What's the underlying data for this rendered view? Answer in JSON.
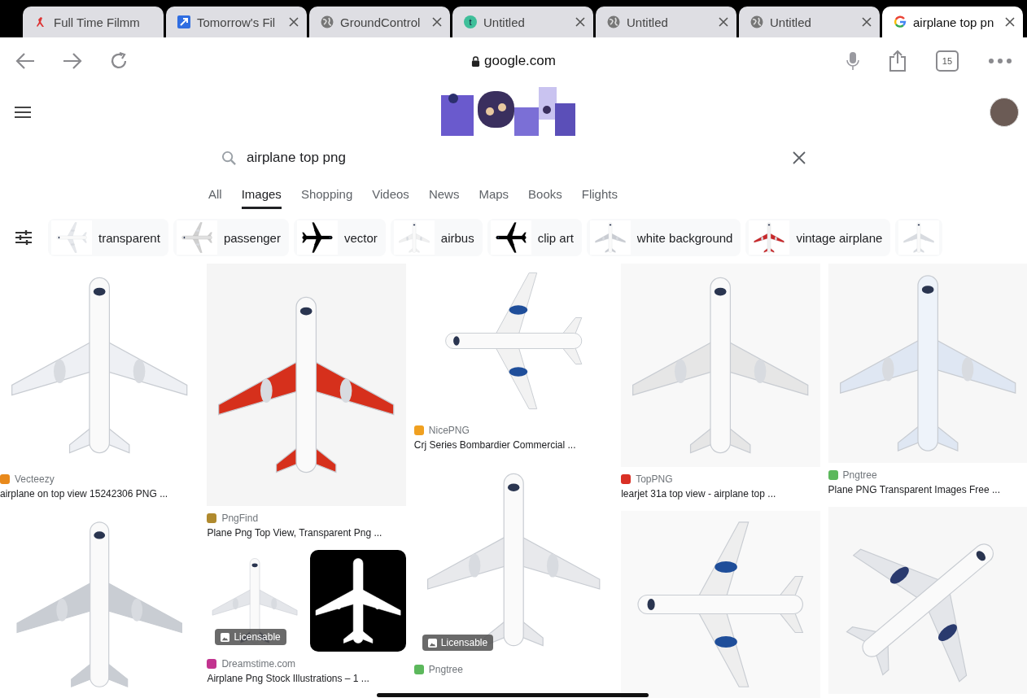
{
  "browser": {
    "tabs": [
      {
        "title": "Full Time Filmm",
        "kind": "figure",
        "closable": false,
        "selected": false
      },
      {
        "title": "Tomorrow's Fil",
        "kind": "square",
        "closable": true,
        "selected": false
      },
      {
        "title": "GroundControl",
        "kind": "globe",
        "closable": true,
        "selected": false
      },
      {
        "title": "Untitled",
        "kind": "letter",
        "favicon_text": "t",
        "closable": true,
        "selected": false
      },
      {
        "title": "Untitled",
        "kind": "globe",
        "closable": true,
        "selected": false
      },
      {
        "title": "Untitled",
        "kind": "globe",
        "closable": true,
        "selected": false
      },
      {
        "title": "airplane top pn",
        "kind": "google",
        "closable": true,
        "selected": true
      }
    ],
    "address": "google.com",
    "tab_count": "15"
  },
  "search": {
    "value": "airplane top png"
  },
  "nav": [
    {
      "label": "All",
      "selected": false
    },
    {
      "label": "Images",
      "selected": true
    },
    {
      "label": "Shopping",
      "selected": false
    },
    {
      "label": "Videos",
      "selected": false
    },
    {
      "label": "News",
      "selected": false
    },
    {
      "label": "Maps",
      "selected": false
    },
    {
      "label": "Books",
      "selected": false
    },
    {
      "label": "Flights",
      "selected": false
    }
  ],
  "chips": [
    {
      "label": "transparent"
    },
    {
      "label": "passenger"
    },
    {
      "label": "vector"
    },
    {
      "label": "airbus"
    },
    {
      "label": "clip art"
    },
    {
      "label": "white background"
    },
    {
      "label": "vintage airplane"
    },
    {
      "kind": "picture"
    }
  ],
  "results": [
    [
      {
        "pictures": [
          {
            "kind": "picture"
          }
        ],
        "source": "Vecteezy",
        "color": "#e8891c",
        "title": "airplane on top view 15242306 PNG ..."
      },
      {
        "pictures": [
          {
            "kind": "picture"
          }
        ]
      }
    ],
    [
      {
        "pictures": [
          {
            "kind": "picture"
          }
        ],
        "source": "PngFind",
        "color": "#b08a2e",
        "title": "Plane Png Top View, Transparent Png ..."
      },
      {
        "pictures": [
          {
            "kind": "picture",
            "badge": "Licensable"
          },
          {
            "kind": "picture"
          }
        ],
        "source": "Dreamstime.com",
        "color": "#c2338f",
        "title": "Airplane Png Stock Illustrations – 1 ..."
      }
    ],
    [
      {
        "pictures": [
          {
            "kind": "picture"
          }
        ],
        "source": "NicePNG",
        "color": "#f0a020",
        "title": "Crj Series Bombardier Commercial ..."
      },
      {
        "pictures": [
          {
            "kind": "picture",
            "badge": "Licensable"
          }
        ],
        "source": "Pngtree",
        "color": "#5cb85c"
      }
    ],
    [
      {
        "pictures": [
          {
            "kind": "picture"
          }
        ],
        "source": "TopPNG",
        "color": "#d93025",
        "title": "learjet 31a top view - airplane top ..."
      },
      {
        "pictures": [
          {
            "kind": "picture"
          }
        ]
      }
    ],
    [
      {
        "pictures": [
          {
            "kind": "picture"
          }
        ],
        "source": "Pngtree",
        "color": "#5cb85c",
        "title": "Plane PNG Transparent Images Free ..."
      },
      {
        "pictures": [
          {
            "kind": "picture"
          }
        ]
      }
    ]
  ]
}
